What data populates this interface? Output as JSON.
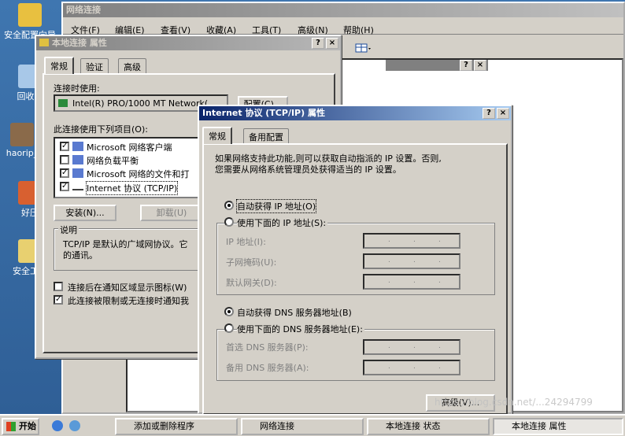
{
  "desktop": {
    "icons": [
      "安全配置向导",
      "回收站",
      "haorip_",
      "好压",
      "安全工具"
    ]
  },
  "net_window": {
    "title": "网络连接",
    "menu": [
      "文件(F)",
      "编辑(E)",
      "查看(V)",
      "收藏(A)",
      "工具(T)",
      "高级(N)",
      "帮助(H)"
    ]
  },
  "props": {
    "title": "本地连接 属性",
    "tabs": [
      "常规",
      "验证",
      "高级"
    ],
    "connect_using": "连接时使用:",
    "adapter": "Intel(R) PRO/1000 MT Network(",
    "config_btn": "配置(C)...",
    "items_label": "此连接使用下列项目(O):",
    "items": [
      "Microsoft 网络客户端",
      "网络负载平衡",
      "Microsoft 网络的文件和打",
      "Internet 协议 (TCP/IP)"
    ],
    "install_btn": "安装(N)...",
    "uninstall_btn": "卸载(U)",
    "desc_title": "说明",
    "desc_text": "TCP/IP 是默认的广域网协议。它",
    "desc_text2": "的通讯。",
    "chk1": "连接后在通知区域显示图标(W)",
    "chk2": "此连接被限制或无连接时通知我"
  },
  "tcpip": {
    "title": "Internet 协议 (TCP/IP) 属性",
    "tabs": [
      "常规",
      "备用配置"
    ],
    "intro1": "如果网络支持此功能,则可以获取自动指派的 IP 设置。否则,",
    "intro2": "您需要从网络系统管理员处获得适当的 IP 设置。",
    "auto_ip": "自动获得 IP 地址(O)",
    "manual_ip": "使用下面的 IP 地址(S):",
    "ip_label": "IP 地址(I):",
    "mask_label": "子网掩码(U):",
    "gw_label": "默认网关(D):",
    "auto_dns": "自动获得 DNS 服务器地址(B)",
    "manual_dns": "使用下面的 DNS 服务器地址(E):",
    "dns1_label": "首选 DNS 服务器(P):",
    "dns2_label": "备用 DNS 服务器(A):",
    "advanced_btn": "高级(V)..."
  },
  "taskbar": {
    "start": "开始",
    "items": [
      "添加或删除程序",
      "网络连接",
      "本地连接 状态",
      "本地连接 属性"
    ]
  },
  "watermark": "https://blog.csdn.net/...24294799",
  "colors": {
    "title_active": "#0a246a",
    "face": "#d4d0c8"
  }
}
